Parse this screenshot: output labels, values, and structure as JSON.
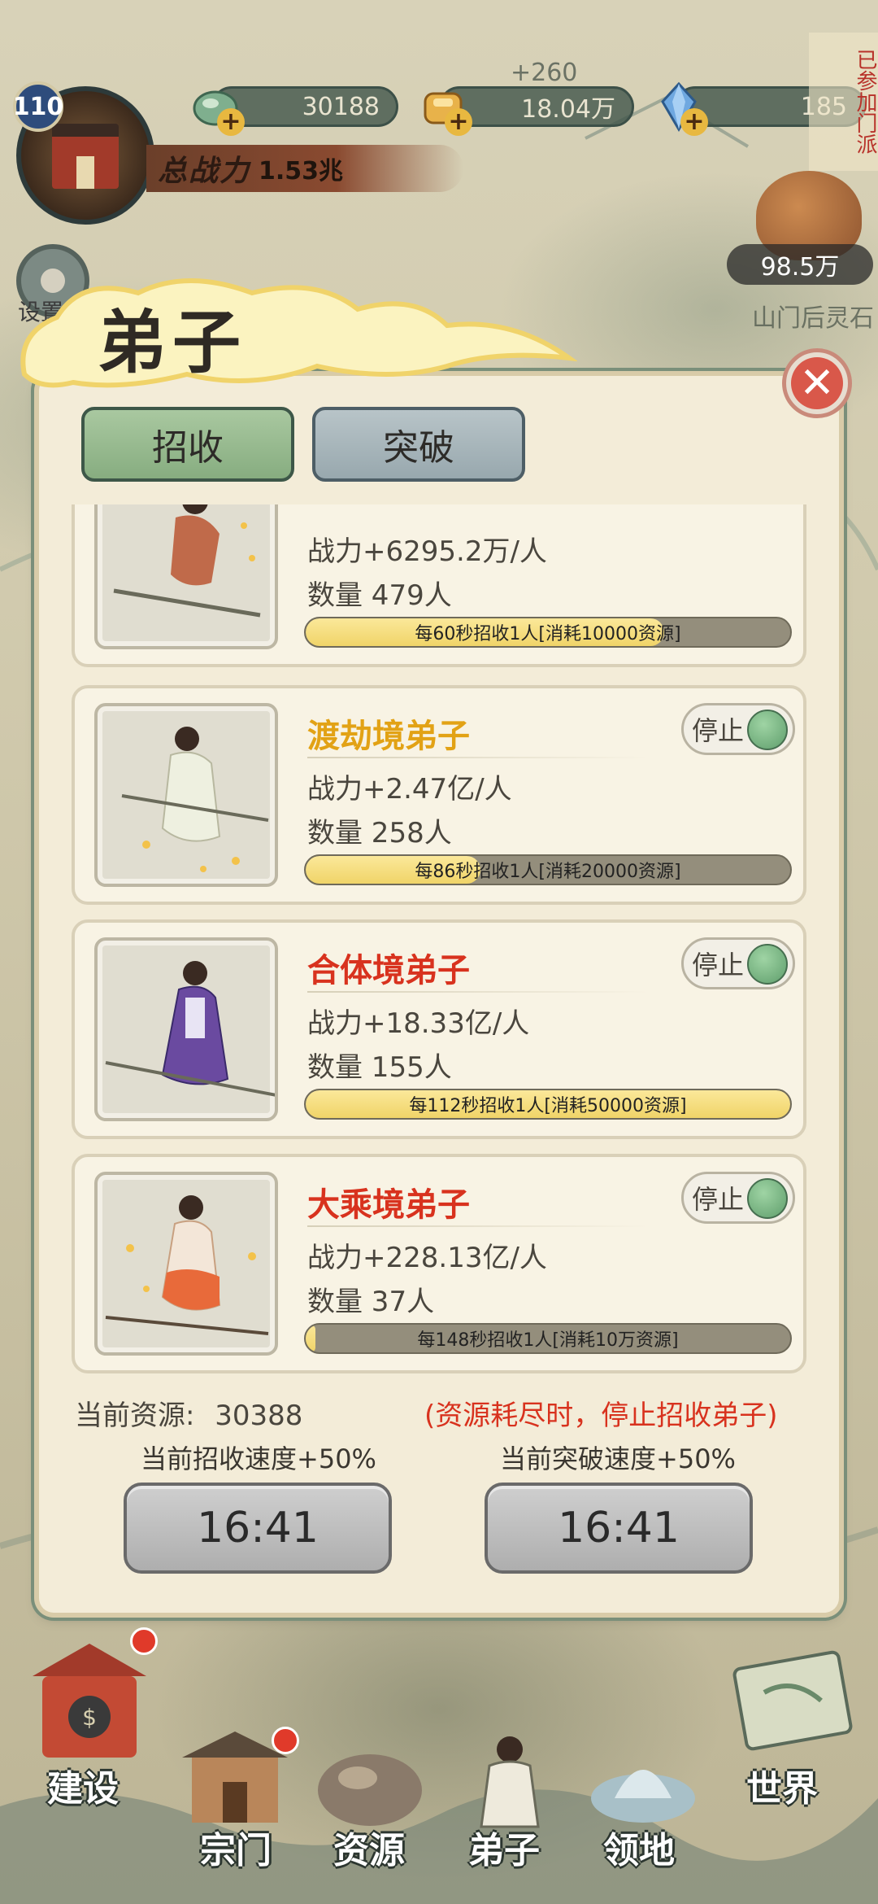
{
  "hud": {
    "level": "110",
    "power_label": "总战力",
    "power_value": "1.53兆",
    "float_gain": "+260",
    "resources": [
      {
        "name": "jade-stone",
        "value": "30188"
      },
      {
        "name": "gold-ingot",
        "value": "18.04万"
      },
      {
        "name": "crystal",
        "value": "185"
      }
    ],
    "sect_flag": "已参加门派",
    "bag_amount": "98.5万",
    "bag_label": "山门后灵石",
    "settings_label": "设置"
  },
  "panel": {
    "title": "弟子",
    "tabs": {
      "recruit": "招收",
      "breakthrough": "突破"
    },
    "toggle_label": "停止",
    "cards": [
      {
        "name": "",
        "power": "战力+6295.2万/人",
        "count": "数量 479人",
        "progress_text": "每60秒招收1人[消耗10000资源]",
        "progress": 0.74,
        "name_color": "#e2a215"
      },
      {
        "name": "渡劫境弟子",
        "power": "战力+2.47亿/人",
        "count": "数量 258人",
        "progress_text": "每86秒招收1人[消耗20000资源]",
        "progress": 0.36,
        "name_color": "#e2a215"
      },
      {
        "name": "合体境弟子",
        "power": "战力+18.33亿/人",
        "count": "数量 155人",
        "progress_text": "每112秒招收1人[消耗50000资源]",
        "progress": 1.0,
        "name_color": "#d8321e"
      },
      {
        "name": "大乘境弟子",
        "power": "战力+228.13亿/人",
        "count": "数量 37人",
        "progress_text": "每148秒招收1人[消耗10万资源]",
        "progress": 0.02,
        "name_color": "#d8321e"
      }
    ],
    "current_resource_label": "当前资源:",
    "current_resource_value": "30388",
    "warning": "(资源耗尽时，停止招收弟子)",
    "recruit_speed": "当前招收速度+50%",
    "break_speed": "当前突破速度+50%",
    "recruit_timer": "16:41",
    "break_timer": "16:41"
  },
  "nav": {
    "build": "建设",
    "sect": "宗门",
    "resource": "资源",
    "disciple": "弟子",
    "territory": "领地",
    "world": "世界"
  },
  "colors": {
    "accent_green": "#87ad80",
    "name_orange": "#e2a215",
    "name_red": "#d8321e",
    "panel_bg": "#f3ecd8"
  }
}
